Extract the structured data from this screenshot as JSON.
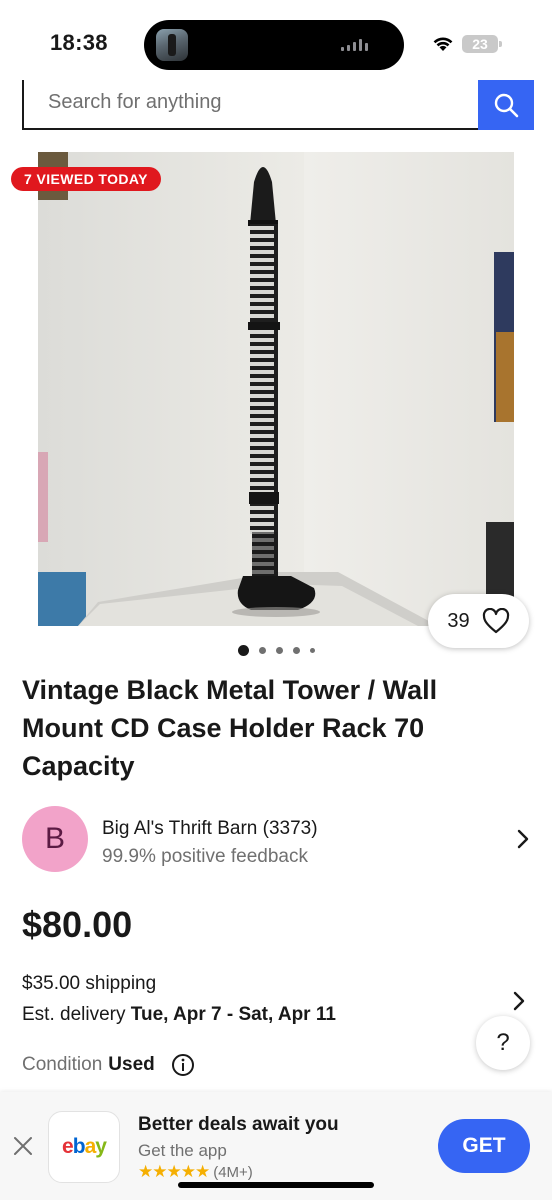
{
  "status_bar": {
    "time": "18:38",
    "battery": "23"
  },
  "search": {
    "placeholder": "Search for anything",
    "icon": "search-icon"
  },
  "listing": {
    "viewed_badge": "7 VIEWED TODAY",
    "watch_count": "39",
    "image_count": 5,
    "active_image_index": 0,
    "title": "Vintage Black Metal Tower / Wall Mount CD Case Holder Rack 70 Capacity",
    "price": "$80.00",
    "shipping": "$35.00 shipping",
    "delivery_label": "Est. delivery ",
    "delivery_dates": "Tue, Apr 7 - Sat, Apr 11",
    "condition_label": "Condition",
    "condition_value": "Used"
  },
  "seller": {
    "avatar_letter": "B",
    "name": "Big Al's Thrift Barn (3373)",
    "feedback": "99.9% positive feedback"
  },
  "help": {
    "label": "?"
  },
  "app_banner": {
    "logo": "ebay",
    "title": "Better deals await you",
    "subtitle": "Get the app",
    "stars": "★★★★★",
    "rating_count": "(4M+)",
    "cta": "GET"
  },
  "colors": {
    "accent": "#3665f3",
    "badge_red": "#e0181e",
    "avatar_pink": "#f2a3c9",
    "star_yellow": "#f5af02"
  }
}
